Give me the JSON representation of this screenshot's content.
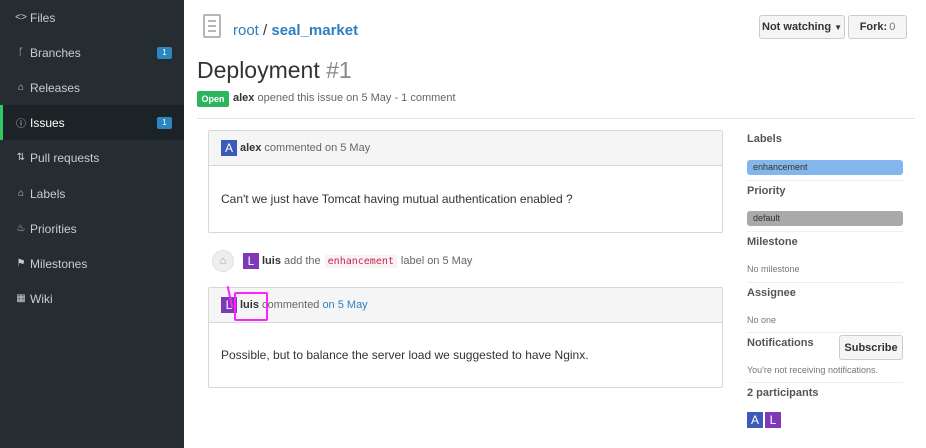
{
  "sidebar": {
    "items": [
      {
        "label": "Files",
        "icon": "code-icon",
        "glyph": "<>"
      },
      {
        "label": "Branches",
        "icon": "branch-icon",
        "glyph": "ᚴ",
        "count": "1"
      },
      {
        "label": "Releases",
        "icon": "tag-icon",
        "glyph": "⌂"
      },
      {
        "label": "Issues",
        "icon": "issue-icon",
        "glyph": "ⓘ",
        "count": "1"
      },
      {
        "label": "Pull requests",
        "icon": "pull-request-icon",
        "glyph": "⇅"
      },
      {
        "label": "Labels",
        "icon": "tag-icon",
        "glyph": "⌂"
      },
      {
        "label": "Priorities",
        "icon": "flame-icon",
        "glyph": "♨"
      },
      {
        "label": "Milestones",
        "icon": "milestone-icon",
        "glyph": "⚑"
      },
      {
        "label": "Wiki",
        "icon": "book-icon",
        "glyph": "▦"
      }
    ],
    "active_label": "Issues"
  },
  "header": {
    "owner": "root",
    "separator": "/",
    "repo": "seal_market",
    "watch_label": "Not watching",
    "fork_label": "Fork:",
    "fork_count": "0"
  },
  "issue": {
    "title": "Deployment",
    "number": "#1",
    "state": "Open",
    "author": "alex",
    "meta": "opened this issue on 5 May - 1 comment"
  },
  "comments": [
    {
      "author": "alex",
      "initial": "A",
      "action": "commented on 5 May",
      "body": "Can't we just have Tomcat having mutual authentication enabled ?"
    },
    {
      "author": "luis",
      "initial": "L",
      "action": "commented",
      "date": "on 5 May",
      "body": "Possible, but to balance the server load we suggested to have Nginx."
    }
  ],
  "event": {
    "author": "luis",
    "initial": "L",
    "before": "add the",
    "label": "enhancement",
    "after": "label on 5 May"
  },
  "side": {
    "labels_heading": "Labels",
    "label_value": "enhancement",
    "label_color": "#84b6eb",
    "priority_heading": "Priority",
    "priority_value": "default",
    "priority_color": "#a9a9a9",
    "milestone_heading": "Milestone",
    "milestone_value": "No milestone",
    "assignee_heading": "Assignee",
    "assignee_value": "No one",
    "notifications_heading": "Notifications",
    "subscribe_label": "Subscribe",
    "notifications_status": "You're not receiving notifications.",
    "participants_heading": "2 participants",
    "participants": [
      "A",
      "L"
    ]
  }
}
